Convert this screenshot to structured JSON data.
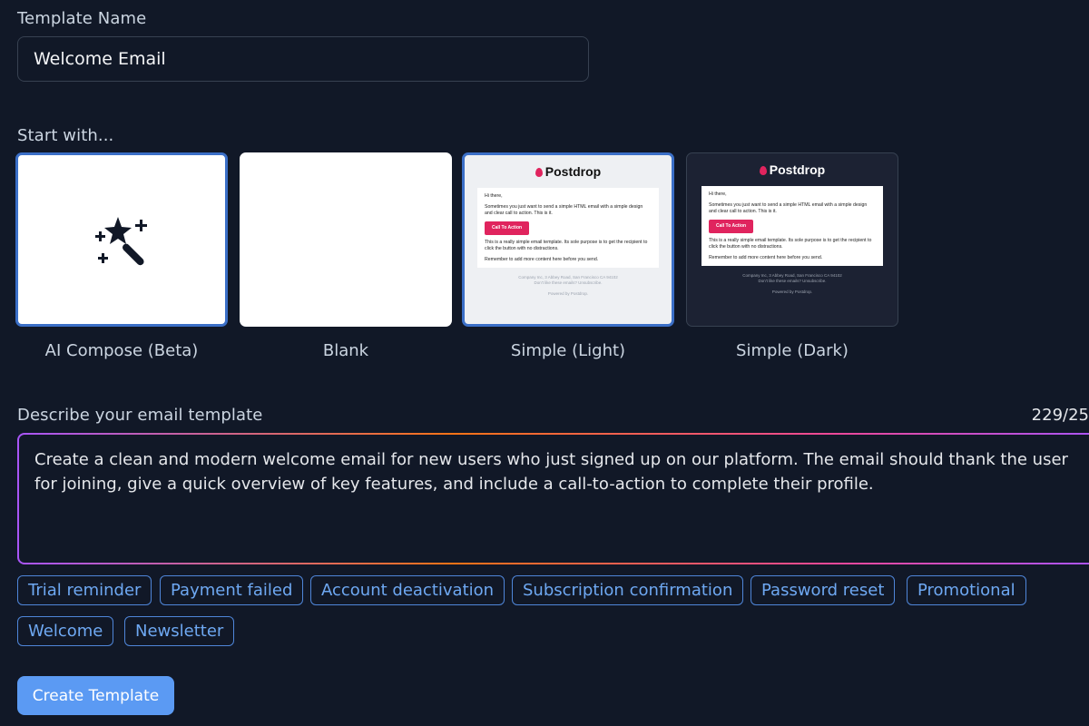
{
  "form": {
    "template_name_label": "Template Name",
    "template_name_value": "Welcome Email",
    "start_with_label": "Start with...",
    "describe_label": "Describe your email template",
    "char_counter": "229/25",
    "description": "Create a clean and modern welcome email for new users who just signed up on our platform. The email should thank the user for joining, give a quick overview of key features, and include a call-to-action to complete their profile.",
    "create_button": "Create Template"
  },
  "templates": [
    {
      "label": "AI Compose (Beta)",
      "icon": "magic-wand-icon",
      "selected": true
    },
    {
      "label": "Blank",
      "selected": false
    },
    {
      "label": "Simple (Light)",
      "selected": true
    },
    {
      "label": "Simple (Dark)",
      "selected": false
    }
  ],
  "preview": {
    "logo": "Postdrop",
    "greeting": "Hi there,",
    "line1": "Sometimes you just want to send a simple HTML email with a simple design and clear call to action. This is it.",
    "cta": "Call To Action",
    "line2": "This is a really simple email template. Its sole purpose is to get the recipient to click the button with no distractions.",
    "line3": "Remember to add more content here before you send.",
    "footer_address": "Company Inc, 3 Abbey Road, San Francisco CA 94102",
    "footer_unsub": "Don't like these emails? Unsubscribe.",
    "footer_powered": "Powered by Postdrop."
  },
  "suggestions": [
    "Trial reminder",
    "Payment failed",
    "Account deactivation",
    "Subscription confirmation",
    "Password reset",
    "Promotional",
    "Welcome",
    "Newsletter"
  ],
  "colors": {
    "background": "#111827",
    "accent": "#5b9af3",
    "chip_border": "#4f86d9",
    "brand_pink": "#e0245e"
  }
}
